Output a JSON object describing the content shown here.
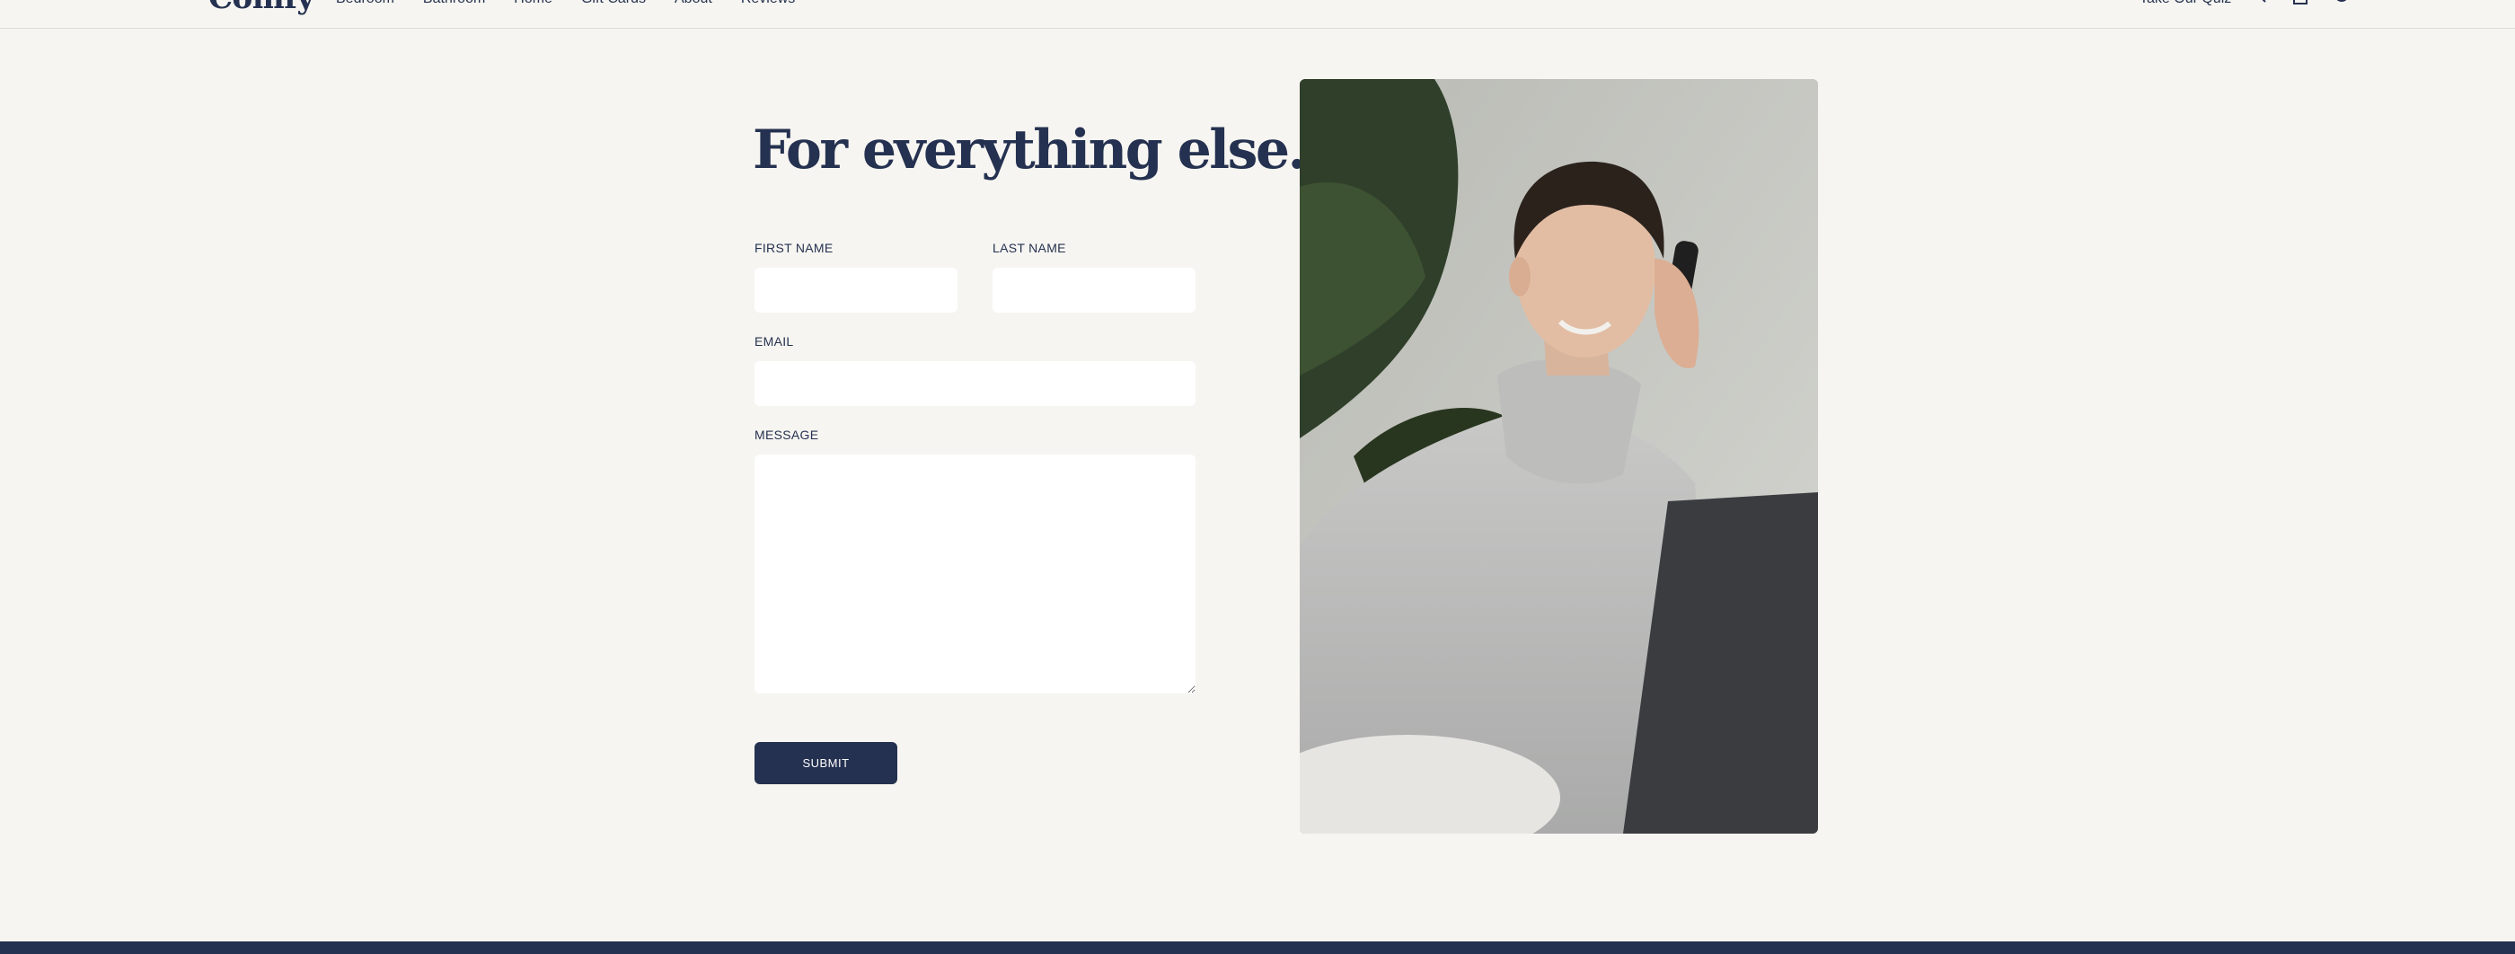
{
  "header": {
    "logo": "Comfy",
    "nav": [
      "Bedroom",
      "Bathroom",
      "Home",
      "Gift Cards",
      "About",
      "Reviews"
    ],
    "quiz_link": "Take Our Quiz",
    "icons": [
      "search-icon",
      "bag-icon",
      "account-icon"
    ]
  },
  "contact_form": {
    "title": "For everything else...",
    "first_name_label": "FIRST NAME",
    "last_name_label": "LAST NAME",
    "email_label": "EMAIL",
    "message_label": "MESSAGE",
    "first_name_value": "",
    "last_name_value": "",
    "email_value": "",
    "message_value": "",
    "submit_label": "SUBMIT"
  },
  "colors": {
    "background": "#f6f5f1",
    "navy": "#253150",
    "field": "#ffffff"
  }
}
